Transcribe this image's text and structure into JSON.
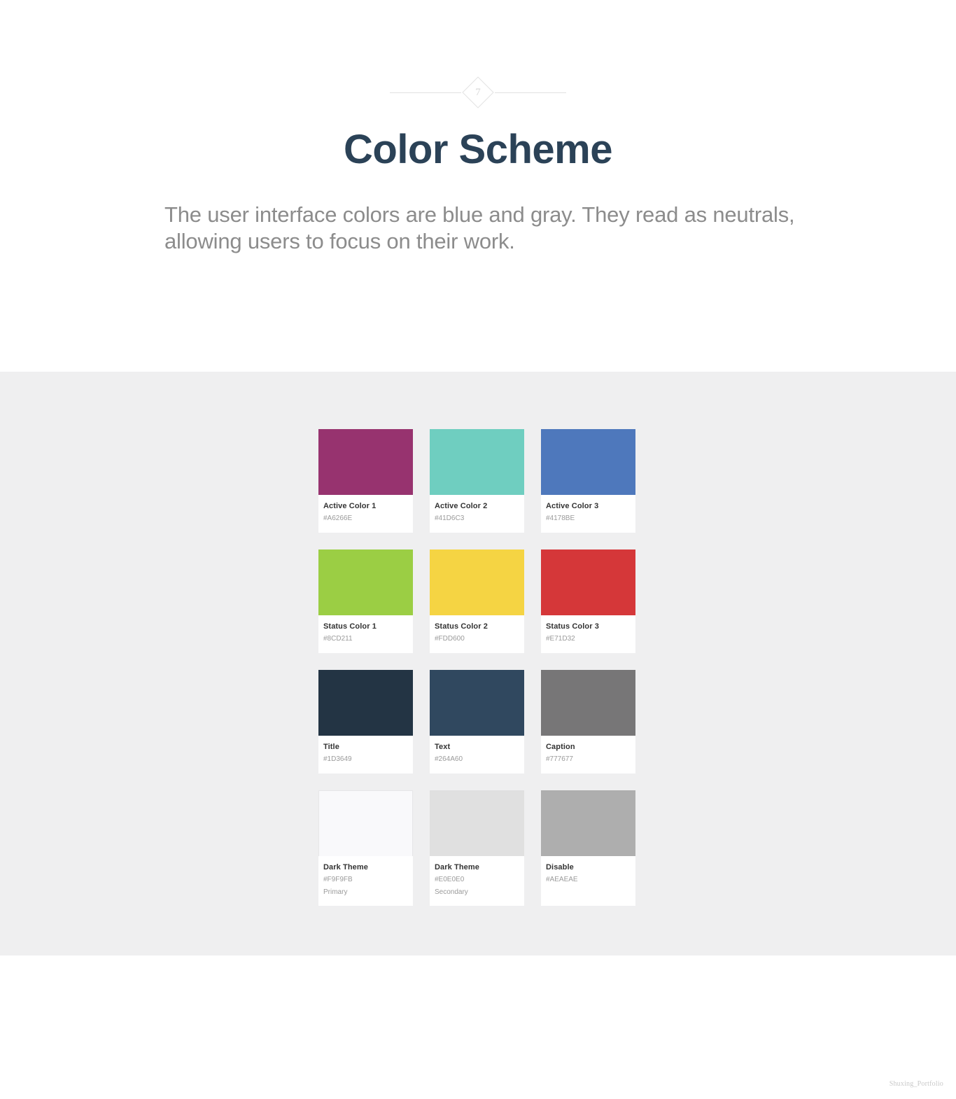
{
  "header": {
    "section_number": "7",
    "title": "Color Scheme",
    "subtitle": "The user interface colors are blue and gray. They read as neutrals, allowing users to focus on their work.",
    "title_color": "#2B4257",
    "subtitle_color": "#8C8C8C"
  },
  "section": {
    "background_color": "#EFEFF0"
  },
  "swatches": {
    "rows": [
      {
        "cards": [
          {
            "name": "Active Color 1",
            "hex": "#A6266E",
            "note": "",
            "swatch_color": "#97336F",
            "bordered": false
          },
          {
            "name": "Active Color 2",
            "hex": "#41D6C3",
            "note": "",
            "swatch_color": "#6FCEC0",
            "bordered": false
          },
          {
            "name": "Active Color 3",
            "hex": "#4178BE",
            "note": "",
            "swatch_color": "#4E78BC",
            "bordered": false
          }
        ]
      },
      {
        "cards": [
          {
            "name": "Status Color 1",
            "hex": "#8CD211",
            "note": "",
            "swatch_color": "#9BCE44",
            "bordered": false
          },
          {
            "name": "Status Color 2",
            "hex": "#FDD600",
            "note": "",
            "swatch_color": "#F5D443",
            "bordered": false
          },
          {
            "name": "Status Color 3",
            "hex": "#E71D32",
            "note": "",
            "swatch_color": "#D53739",
            "bordered": false
          }
        ]
      },
      {
        "cards": [
          {
            "name": "Title",
            "hex": "#1D3649",
            "note": "",
            "swatch_color": "#233444",
            "bordered": false
          },
          {
            "name": "Text",
            "hex": "#264A60",
            "note": "",
            "swatch_color": "#30485F",
            "bordered": false
          },
          {
            "name": "Caption",
            "hex": "#777677",
            "note": "",
            "swatch_color": "#777677",
            "bordered": false
          }
        ]
      },
      {
        "cards": [
          {
            "name": "Dark Theme",
            "hex": "#F9F9FB",
            "note": "Primary",
            "swatch_color": "#F9F9FB",
            "bordered": true
          },
          {
            "name": "Dark Theme",
            "hex": "#E0E0E0",
            "note": "Secondary",
            "swatch_color": "#E0E0E0",
            "bordered": false
          },
          {
            "name": "Disable",
            "hex": "#AEAEAE",
            "note": "",
            "swatch_color": "#AEAEAE",
            "bordered": false
          }
        ]
      }
    ]
  },
  "footer": {
    "watermark": "Shuxing_Portfolio"
  }
}
